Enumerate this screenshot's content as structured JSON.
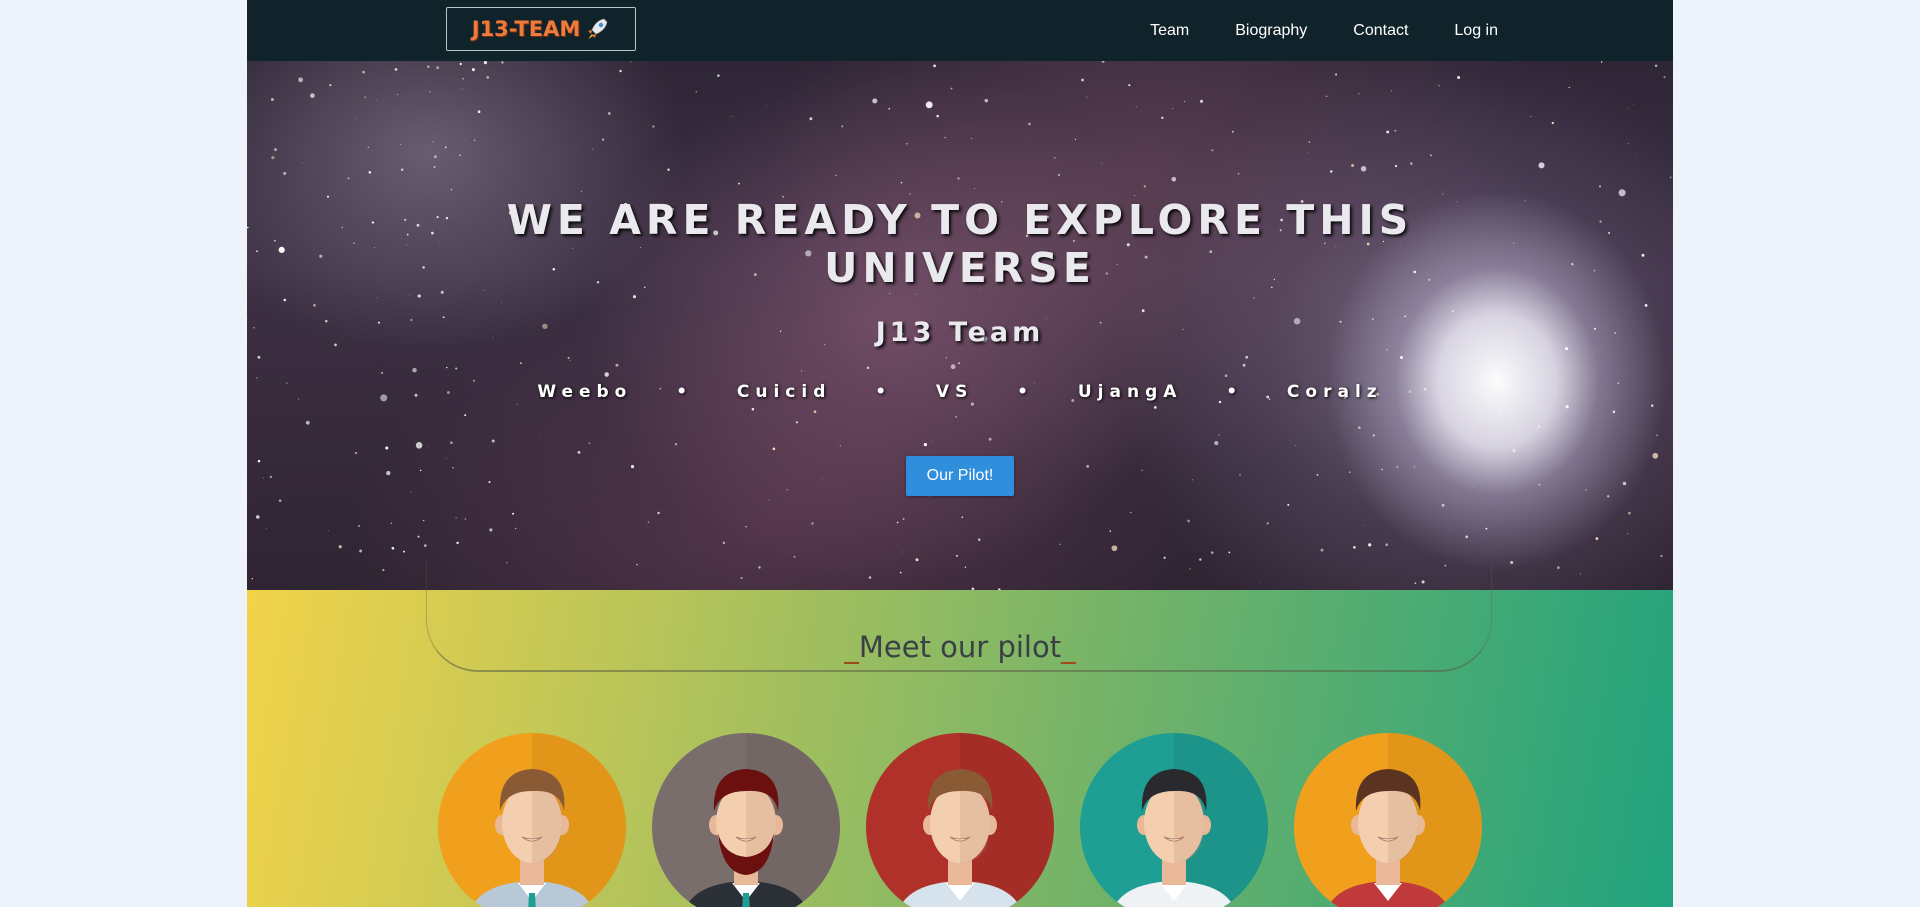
{
  "nav": {
    "logo_text": "J13-TEAM",
    "links": [
      "Team",
      "Biography",
      "Contact",
      "Log in"
    ]
  },
  "hero": {
    "title_line1": "WE ARE READY TO EXPLORE THIS",
    "title_line2": "UNIVERSE",
    "subtitle": "J13 Team",
    "members": "Weebo  •  Cuicid  •  VS  •  UjangA  •  Coralz",
    "cta_label": "Our Pilot!"
  },
  "pilot_section": {
    "heading_prefix": "_",
    "heading_text": "Meet our pilot",
    "heading_suffix": "_"
  },
  "avatars": [
    {
      "name": "pilot-avatar-1",
      "bg": "#f0a01c",
      "hair": "#8a5a34",
      "shirt": "#b8c8d6",
      "tie": "#1f9e93",
      "beard": false
    },
    {
      "name": "pilot-avatar-2",
      "bg": "#7a6e6c",
      "hair": "#6b0f0f",
      "shirt": "#2b2f36",
      "tie": "#1f9e93",
      "beard": true
    },
    {
      "name": "pilot-avatar-3",
      "bg": "#b0302a",
      "hair": "#8a5a34",
      "shirt": "#d6e2ec",
      "tie": "",
      "beard": false
    },
    {
      "name": "pilot-avatar-4",
      "bg": "#1f9e93",
      "hair": "#2a2a2e",
      "shirt": "#eef2f4",
      "tie": "",
      "beard": false
    },
    {
      "name": "pilot-avatar-5",
      "bg": "#f0a01c",
      "hair": "#5a3420",
      "shirt": "#c0393b",
      "tie": "",
      "beard": false
    }
  ],
  "colors": {
    "navbar": "#12242c",
    "cta": "#2f8fdc",
    "logo_text": "#ee7b3c"
  }
}
